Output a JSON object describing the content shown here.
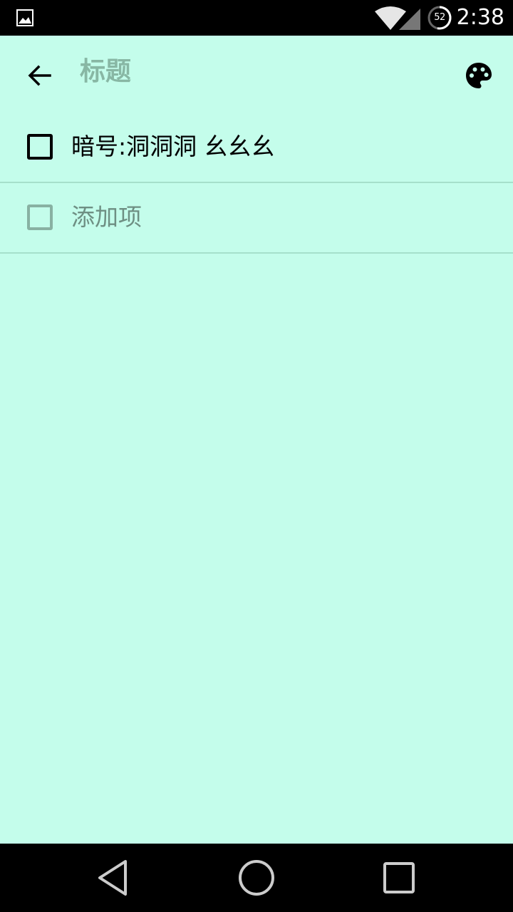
{
  "status_bar": {
    "time": "2:38",
    "battery_level": "52",
    "icons": [
      "gallery-icon",
      "wifi-icon",
      "cell-signal-icon",
      "battery-icon"
    ]
  },
  "app_bar": {
    "title_placeholder": "标题",
    "icons": [
      "arrow-back-icon",
      "palette-icon"
    ]
  },
  "items": [
    {
      "text": "暗号:洞洞洞 幺幺幺",
      "checked": false
    }
  ],
  "add_item": {
    "label": "添加项"
  },
  "nav_bar": {
    "icons": [
      "nav-back-icon",
      "nav-home-icon",
      "nav-recent-icon"
    ]
  },
  "colors": {
    "background": "#c4fdeb",
    "divider": "#a6e0cb",
    "placeholder_text": "#88b7a4",
    "faded_text": "#6e8f83",
    "bars": "#000000"
  }
}
